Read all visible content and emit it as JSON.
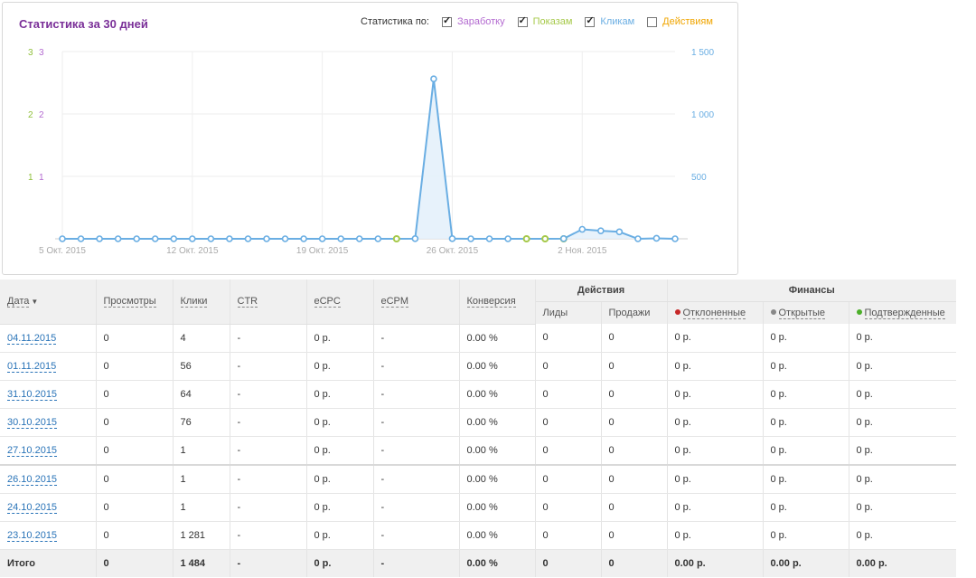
{
  "chart_panel": {
    "title": "Статистика за 30 дней",
    "legend_label": "Статистика по:",
    "legend": [
      {
        "label": "Заработку",
        "checked": true,
        "color": "#b36ad0"
      },
      {
        "label": "Показам",
        "checked": true,
        "color": "#a6c94a"
      },
      {
        "label": "Кликам",
        "checked": true,
        "color": "#6aaee3"
      },
      {
        "label": "Действиям",
        "checked": false,
        "color": "#f0a500"
      }
    ]
  },
  "chart_data": {
    "type": "line",
    "left_axis_ticks": [
      {
        "green": "3",
        "purple": "3"
      },
      {
        "green": "2",
        "purple": "2"
      },
      {
        "green": "1",
        "purple": "1"
      }
    ],
    "right_axis_ticks": [
      "1 500",
      "1 000",
      "500"
    ],
    "ylim_right": [
      0,
      1500
    ],
    "ylim_left": [
      0,
      3
    ],
    "x_tick_labels": [
      "5 Окт. 2015",
      "12 Окт. 2015",
      "19 Окт. 2015",
      "26 Окт. 2015",
      "2 Ноя. 2015"
    ],
    "x_tick_indices": [
      0,
      7,
      14,
      21,
      28
    ],
    "point_count": 31,
    "series": [
      {
        "name": "Кликам",
        "color": "#6aaee3",
        "values": [
          0,
          0,
          0,
          0,
          0,
          0,
          0,
          0,
          0,
          0,
          0,
          0,
          0,
          0,
          0,
          0,
          0,
          0,
          0,
          1,
          1281,
          1,
          0,
          0,
          0,
          0,
          0,
          1,
          76,
          64,
          56,
          0,
          4,
          0
        ]
      },
      {
        "name": "Показам",
        "color": "#a6c94a",
        "values": [
          0,
          0,
          0,
          0,
          0,
          0,
          0,
          0,
          0,
          0,
          0,
          0,
          0,
          0,
          0,
          0,
          0,
          0,
          0,
          0,
          0,
          0,
          0,
          0,
          0,
          0,
          0,
          0,
          0,
          0,
          0,
          0,
          0,
          0
        ]
      }
    ],
    "grid": true
  },
  "table": {
    "headers": {
      "date": "Дата",
      "views": "Просмотры",
      "clicks": "Клики",
      "ctr": "CTR",
      "ecpc": "eCPC",
      "ecpm": "eCPM",
      "conversion": "Конверсия",
      "actions_group": "Действия",
      "leads": "Лиды",
      "sales": "Продажи",
      "finance_group": "Финансы",
      "rejected": "Отклоненные",
      "open": "Открытые",
      "confirmed": "Подтвержденные"
    },
    "status_colors": {
      "rejected": "#c62828",
      "open": "#888888",
      "confirmed": "#4caf2a"
    },
    "rows": [
      {
        "date": "04.11.2015",
        "views": "0",
        "clicks": "4",
        "ctr": "-",
        "ecpc": "0 р.",
        "ecpm": "-",
        "conv": "0.00 %",
        "leads": "0",
        "sales": "0",
        "rejected": "0 р.",
        "open": "0 р.",
        "confirmed": "0 р."
      },
      {
        "date": "01.11.2015",
        "views": "0",
        "clicks": "56",
        "ctr": "-",
        "ecpc": "0 р.",
        "ecpm": "-",
        "conv": "0.00 %",
        "leads": "0",
        "sales": "0",
        "rejected": "0 р.",
        "open": "0 р.",
        "confirmed": "0 р."
      },
      {
        "date": "31.10.2015",
        "views": "0",
        "clicks": "64",
        "ctr": "-",
        "ecpc": "0 р.",
        "ecpm": "-",
        "conv": "0.00 %",
        "leads": "0",
        "sales": "0",
        "rejected": "0 р.",
        "open": "0 р.",
        "confirmed": "0 р."
      },
      {
        "date": "30.10.2015",
        "views": "0",
        "clicks": "76",
        "ctr": "-",
        "ecpc": "0 р.",
        "ecpm": "-",
        "conv": "0.00 %",
        "leads": "0",
        "sales": "0",
        "rejected": "0 р.",
        "open": "0 р.",
        "confirmed": "0 р."
      },
      {
        "date": "27.10.2015",
        "views": "0",
        "clicks": "1",
        "ctr": "-",
        "ecpc": "0 р.",
        "ecpm": "-",
        "conv": "0.00 %",
        "leads": "0",
        "sales": "0",
        "rejected": "0 р.",
        "open": "0 р.",
        "confirmed": "0 р."
      },
      {
        "date": "26.10.2015",
        "views": "0",
        "clicks": "1",
        "ctr": "-",
        "ecpc": "0 р.",
        "ecpm": "-",
        "conv": "0.00 %",
        "leads": "0",
        "sales": "0",
        "rejected": "0 р.",
        "open": "0 р.",
        "confirmed": "0 р."
      },
      {
        "date": "24.10.2015",
        "views": "0",
        "clicks": "1",
        "ctr": "-",
        "ecpc": "0 р.",
        "ecpm": "-",
        "conv": "0.00 %",
        "leads": "0",
        "sales": "0",
        "rejected": "0 р.",
        "open": "0 р.",
        "confirmed": "0 р."
      },
      {
        "date": "23.10.2015",
        "views": "0",
        "clicks": "1 281",
        "ctr": "-",
        "ecpc": "0 р.",
        "ecpm": "-",
        "conv": "0.00 %",
        "leads": "0",
        "sales": "0",
        "rejected": "0 р.",
        "open": "0 р.",
        "confirmed": "0 р."
      }
    ],
    "total": {
      "label": "Итого",
      "views": "0",
      "clicks": "1 484",
      "ctr": "-",
      "ecpc": "0 р.",
      "ecpm": "-",
      "conv": "0.00 %",
      "leads": "0",
      "sales": "0",
      "rejected": "0.00 р.",
      "open": "0.00 р.",
      "confirmed": "0.00 р."
    }
  }
}
